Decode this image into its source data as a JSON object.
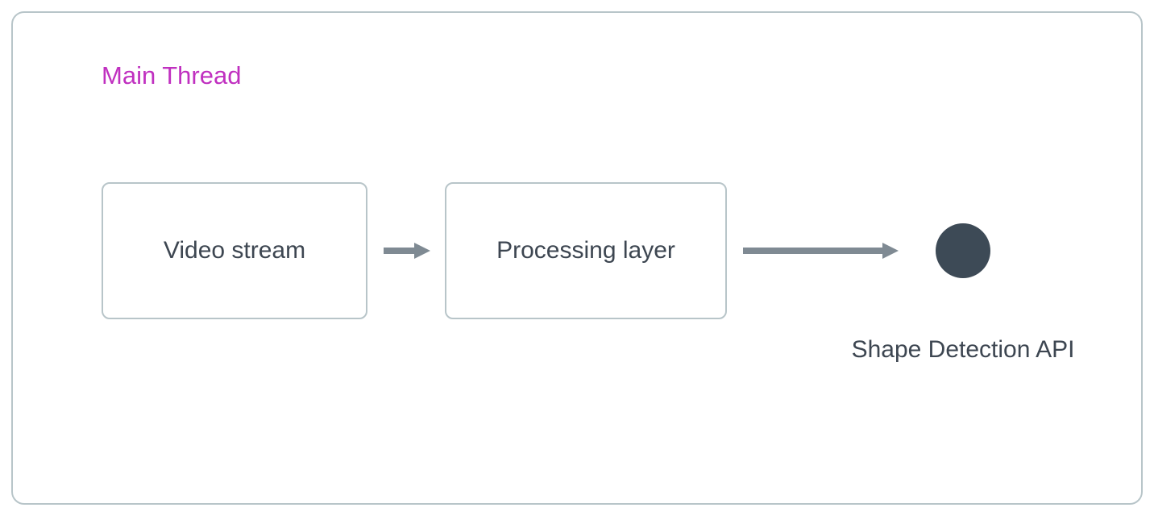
{
  "diagram": {
    "thread_label": "Main Thread",
    "nodes": {
      "video_stream": "Video stream",
      "processing_layer": "Processing layer",
      "shape_detection_api": "Shape Detection API"
    },
    "colors": {
      "border": "#b8c5c9",
      "thread_label": "#c030c0",
      "node_text": "#3d4651",
      "arrow": "#7f8a93",
      "terminal_fill": "#3d4a56"
    }
  }
}
